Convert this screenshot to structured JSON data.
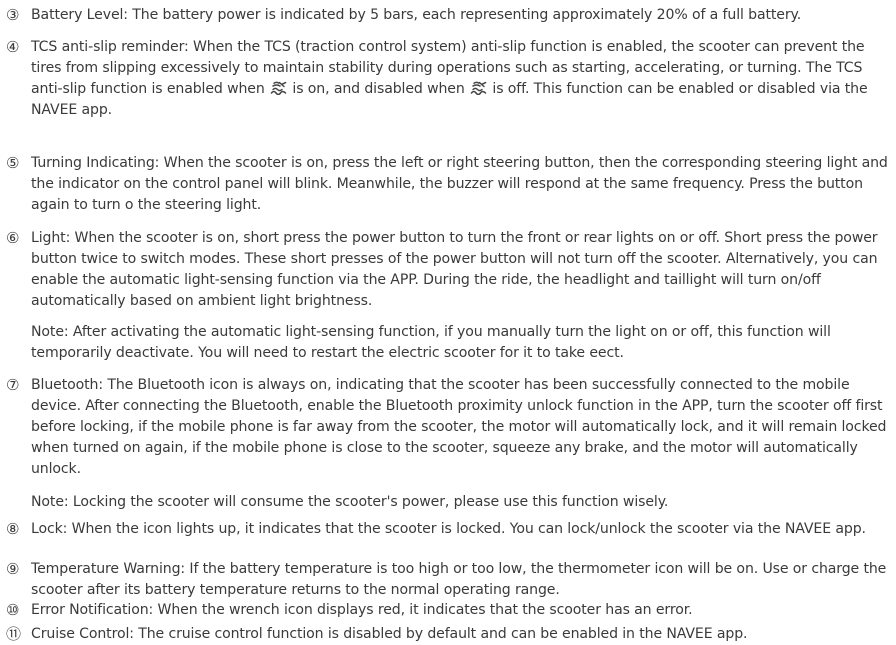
{
  "items": [
    {
      "num": "③",
      "text": "Battery Level: The battery power is indicated by 5 bars, each representing approximately 20% of a full battery."
    },
    {
      "num": "④",
      "text_a": "TCS anti-slip reminder: When the TCS (traction control system) anti-slip function is enabled, the scooter can prevent the tires from slipping excessively to maintain stability during operations such as starting, accelerating, or turning. The TCS anti-slip function is enabled when",
      "text_b": "is on, and disabled when",
      "text_c": "is off. This function can be enabled or disabled via the NAVEE app.",
      "icon": "tcs-icon"
    },
    {
      "num": "⑤",
      "text": "Turning Indicating: When the scooter is on, press the left or right steering button, then the corresponding steering light and the indicator on the control panel will blink. Meanwhile, the buzzer will respond at the same frequency. Press the button again to turn o the steering light."
    },
    {
      "num": "⑥",
      "text": "Light: When the scooter is on, short press the power button to turn the front or rear lights on or off. Short press the power button twice to switch modes. These short presses of the power button will not turn off the scooter. Alternatively, you  can enable the automatic light-sensing function via the APP. During the ride, the headlight and taillight will turn on/off automatically based on ambient light brightness.",
      "note": "Note: After activating the automatic light-sensing function, if you manually turn the light on or off, this function will temporarily deactivate. You will need to restart the electric scooter for it to take eect."
    },
    {
      "num": "⑦",
      "text": "Bluetooth: The Bluetooth icon is always on, indicating that the scooter has been successfully connected to the mobile device. After connecting the Bluetooth, enable the Bluetooth proximity unlock function in the APP, turn the scooter off first before locking, if the mobile phone is far away from the scooter, the motor will automatically lock, and it will remain locked when turned on again, if the mobile phone is close to the scooter, squeeze any brake, and the motor will automatically unlock.",
      "note": "Note: Locking the scooter will consume the scooter's power, please use this function wisely."
    },
    {
      "num": "⑧",
      "text": "Lock: When the icon lights up, it indicates that the scooter is locked. You can lock/unlock the scooter via the NAVEE app."
    },
    {
      "num": "⑨",
      "text": "Temperature Warning: If the battery temperature is too high or too low, the thermometer icon will be on. Use or charge the scooter after its battery temperature returns to the normal operating range."
    },
    {
      "num": "⑩",
      "text": "Error Notification: When the wrench icon displays red, it indicates that the scooter has an error."
    },
    {
      "num": "⑪",
      "text": "Cruise Control: The cruise control function is disabled by default and can be enabled in the NAVEE app."
    }
  ]
}
